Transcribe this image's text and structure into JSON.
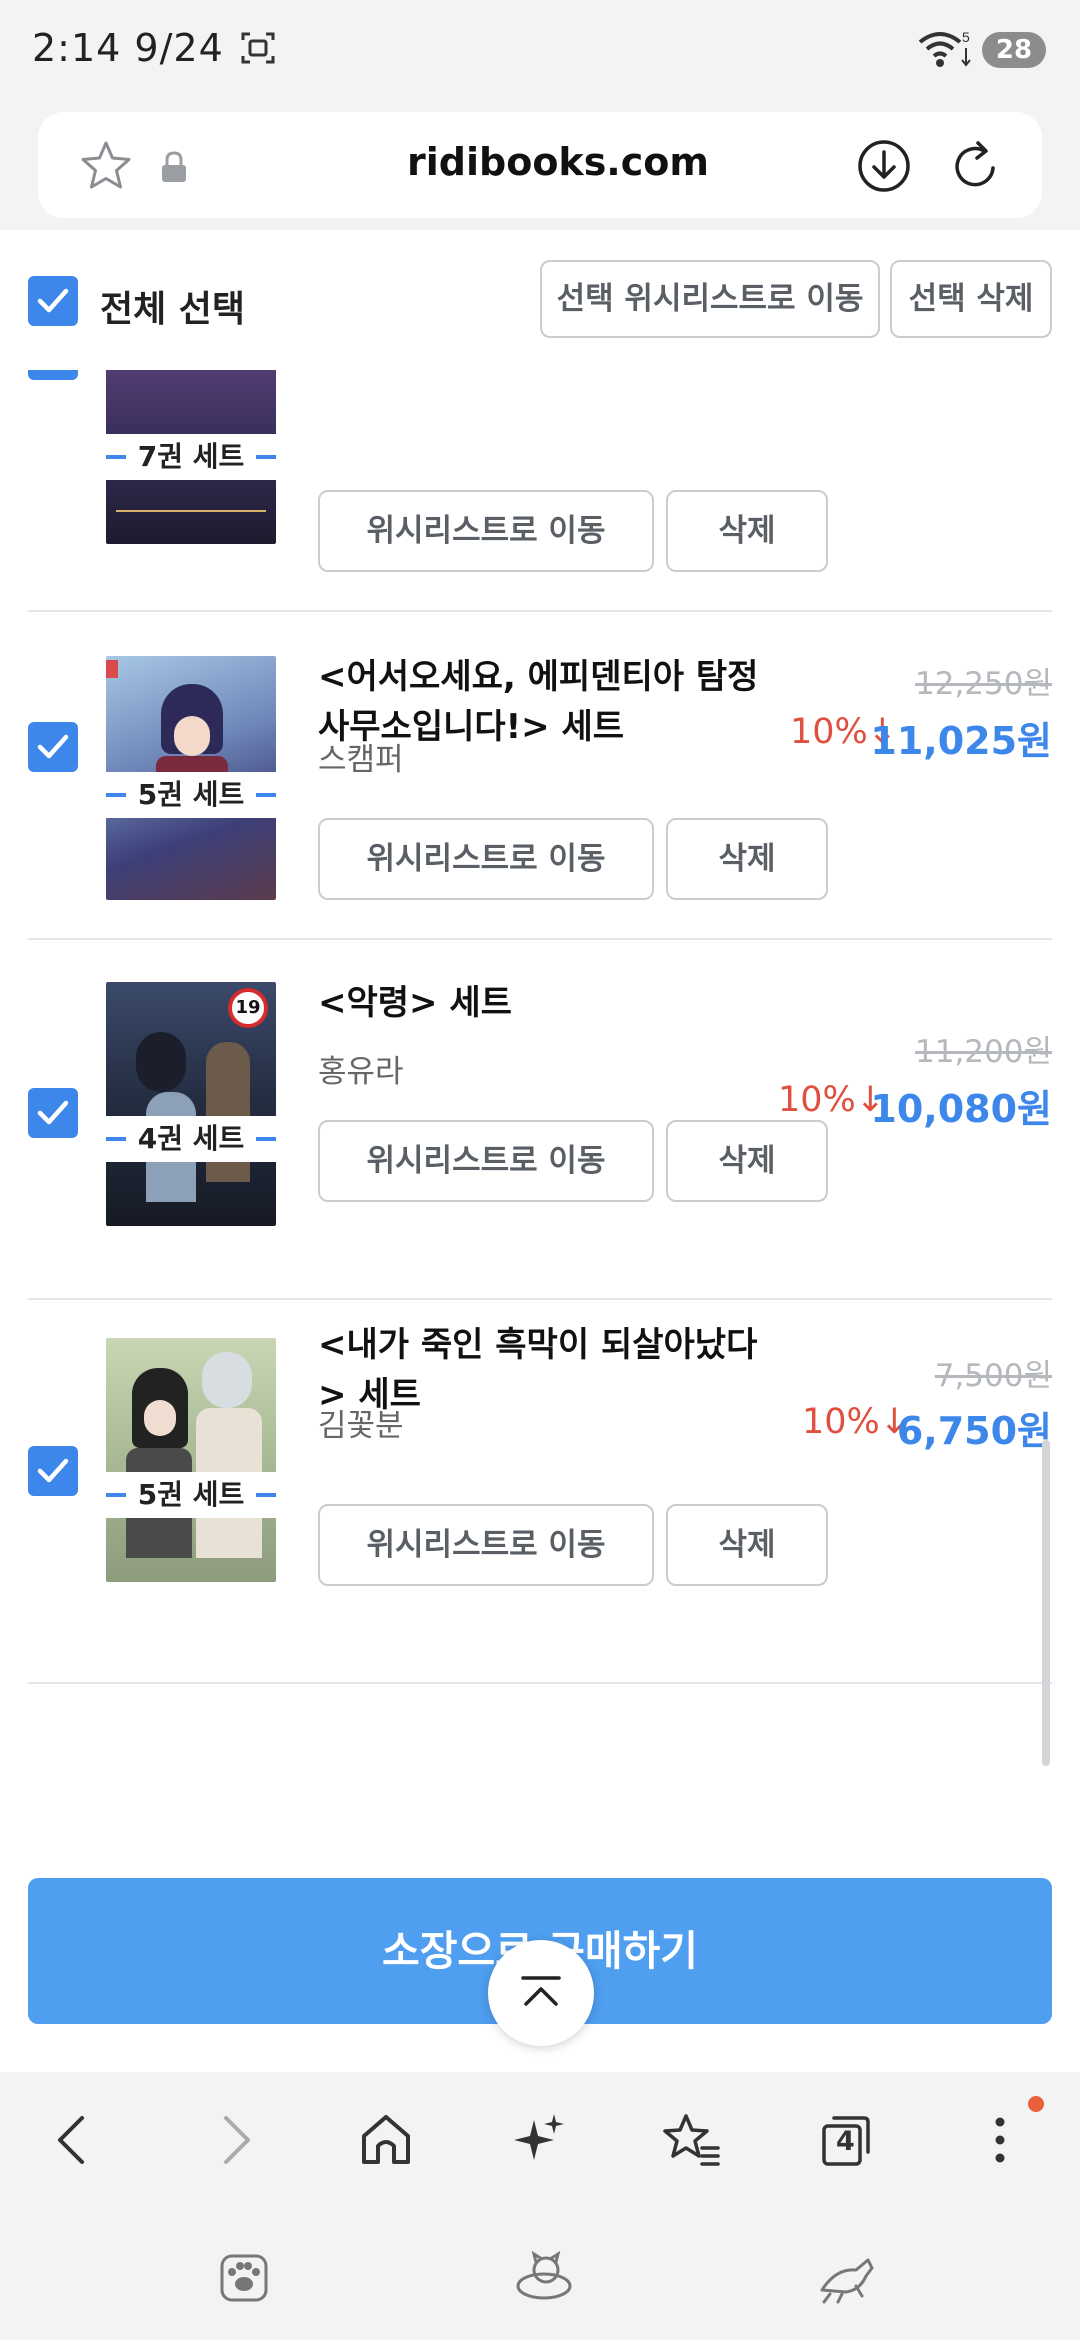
{
  "status_bar": {
    "time": "2:14  9/24",
    "battery": "28",
    "wifi_badge": "5"
  },
  "browser": {
    "url": "ridibooks.com",
    "tab_count": "4"
  },
  "cart": {
    "select_all_label": "전체 선택",
    "move_selected_label": "선택 위시리스트로 이동",
    "delete_selected_label": "선택 삭제",
    "wishlist_button_label": "위시리스트로 이동",
    "delete_button_label": "삭제",
    "items": [
      {
        "badge": "7권 세트",
        "author": "",
        "cover_color": "#3a2f5c"
      },
      {
        "title": "<어서오세요, 에피덴티아 탐정 사무소입니다!> 세트",
        "author": "스캠퍼",
        "badge": "5권 세트",
        "original_price": "12,250원",
        "discount": "10%↓",
        "sale_price": "11,025원",
        "cover_color": "#7b9fc4"
      },
      {
        "title": "<악령> 세트",
        "author": "홍유라",
        "badge": "4권 세트",
        "original_price": "11,200원",
        "discount": "10%↓",
        "sale_price": "10,080원",
        "age_rating": "19",
        "cover_color": "#2c3548"
      },
      {
        "title": "<내가 죽인 흑막이 되살아났다> 세트",
        "author": "김꽃분",
        "badge": "5권 세트",
        "original_price": "7,500원",
        "discount": "10%↓",
        "sale_price": "6,750원",
        "cover_color": "#aebf9a"
      }
    ],
    "purchase_button_label": "소장으로 구매하기"
  },
  "colors": {
    "accent": "#3d87ea",
    "discount": "#e0503e",
    "purchase": "#4f9ef0"
  }
}
